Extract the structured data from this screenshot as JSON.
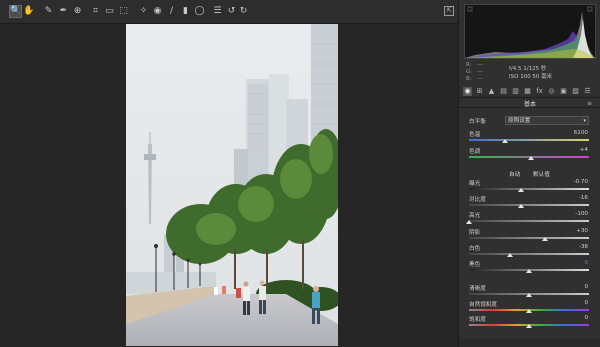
{
  "toolbar": {
    "tools": [
      {
        "icon": "zoom-icon",
        "glyph": "🔍"
      },
      {
        "icon": "hand-icon",
        "glyph": "✋"
      },
      {
        "icon": "white-balance-icon",
        "glyph": "✎"
      },
      {
        "icon": "color-sampler-icon",
        "glyph": "✒"
      },
      {
        "icon": "targeted-adjustment-icon",
        "glyph": "⊕"
      },
      {
        "icon": "crop-icon",
        "glyph": "⌗"
      },
      {
        "icon": "straighten-icon",
        "glyph": "▭"
      },
      {
        "icon": "transform-icon",
        "glyph": "⬚"
      },
      {
        "icon": "spot-removal-icon",
        "glyph": "✧"
      },
      {
        "icon": "red-eye-icon",
        "glyph": "◉"
      },
      {
        "icon": "adjustment-brush-icon",
        "glyph": "/"
      },
      {
        "icon": "graduated-filter-icon",
        "glyph": "▮"
      },
      {
        "icon": "radial-filter-icon",
        "glyph": "◯"
      },
      {
        "icon": "preferences-icon",
        "glyph": "☰"
      },
      {
        "icon": "rotate-ccw-icon",
        "glyph": "↺"
      },
      {
        "icon": "rotate-cw-icon",
        "glyph": "↻"
      }
    ],
    "fullscreen_icon": "fullscreen-icon"
  },
  "histogram": {
    "rgb_labels": [
      "R:",
      "G:",
      "B:"
    ],
    "rgb_values": [
      "---",
      "---",
      "---"
    ],
    "camera_line1": "f/4.5   1/125 秒",
    "camera_line2": "ISO 100   50 毫米"
  },
  "panel_tabs": [
    "basic",
    "tone-curve",
    "detail",
    "hsl",
    "split-toning",
    "lens",
    "effects",
    "camera-calibration",
    "presets",
    "snapshots",
    "menu"
  ],
  "basic": {
    "title": "基本",
    "white_balance_label": "白平衡",
    "white_balance_value": "原照设置",
    "auto_label": "自动",
    "default_label": "默认值",
    "sliders": [
      {
        "label": "色温",
        "value": "6100",
        "pos": 0.3
      },
      {
        "label": "色调",
        "value": "+4",
        "pos": 0.52
      },
      {
        "label": "曝光",
        "value": "-0.70",
        "pos": 0.43
      },
      {
        "label": "对比度",
        "value": "-16",
        "pos": 0.43
      },
      {
        "label": "高光",
        "value": "-100",
        "pos": 0.0
      },
      {
        "label": "阴影",
        "value": "+30",
        "pos": 0.63
      },
      {
        "label": "白色",
        "value": "-38",
        "pos": 0.34
      },
      {
        "label": "黑色",
        "value": "0",
        "pos": 0.5
      },
      {
        "label": "清晰度",
        "value": "0",
        "pos": 0.5
      },
      {
        "label": "自然饱和度",
        "value": "0",
        "pos": 0.5
      },
      {
        "label": "饱和度",
        "value": "0",
        "pos": 0.5
      }
    ]
  },
  "colors": {
    "accent_value": "#3d8fe0"
  }
}
